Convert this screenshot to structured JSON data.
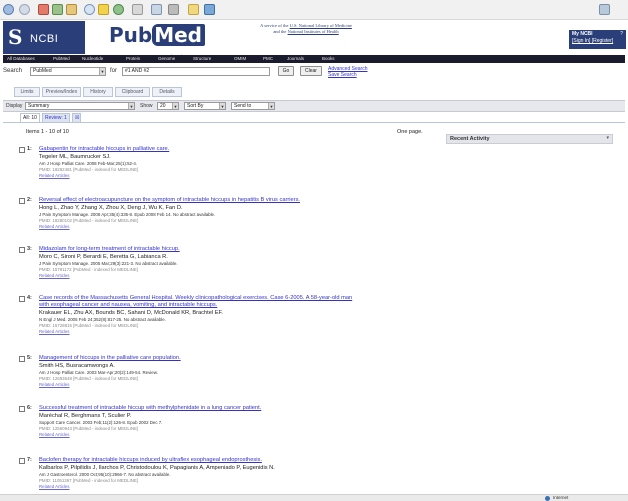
{
  "header": {
    "ncbi_logo_text": "NCBI",
    "pubmed_logo_pub": "Pub",
    "pubmed_logo_med": "Med",
    "pubmed_url": "www.pubmed.gov",
    "service_line1": "A service of the",
    "service_link1": "U.S. National Library of Medicine",
    "service_line2": "and the",
    "service_link2": "National Institutes of Health",
    "my_ncbi_title": "My NCBI",
    "my_ncbi_help": "?",
    "my_ncbi_links": "[Sign In] [Register]"
  },
  "db_nav": [
    "All Databases",
    "PubMed",
    "Nucleotide",
    "Protein",
    "Genome",
    "Structure",
    "OMIM",
    "PMC",
    "Journals",
    "Books"
  ],
  "search": {
    "label": "Search",
    "database": "PubMed",
    "for_label": "for",
    "query": "#1 AND #2",
    "go_label": "Go",
    "clear_label": "Clear",
    "advanced_search": "Advanced Search",
    "save_search": "Save Search"
  },
  "page_tabs": [
    "Limits",
    "Preview/Index",
    "History",
    "Clipboard",
    "Details"
  ],
  "display": {
    "display_label": "Display",
    "display_value": "Summary",
    "show_label": "Show",
    "show_value": "20",
    "sort_value": "Sort By",
    "send_value": "Send to"
  },
  "filter_tabs": {
    "all": "All: 10",
    "review": "Review: 1",
    "icon": "☒"
  },
  "items_count": "Items 1 - 10 of 10",
  "one_page": "One page.",
  "recent_activity": {
    "title": "Recent Activity",
    "collapse": "▾"
  },
  "results": [
    {
      "number": "1:",
      "title_lines": [
        "Gabapentin for intractable hiccups in palliative care."
      ],
      "authors": "Tegeler ML, Baumrucker SJ.",
      "citation": "Am J Hosp Palliat Care. 2008 Feb-Mar;25(1):52-4.",
      "pmid": "PMID: 18292481 [PubMed - indexed for MEDLINE]",
      "related": "Related Articles"
    },
    {
      "number": "2:",
      "title_lines": [
        "Reversal effect of electroacupuncture on the symptom of intractable hiccups in hepatitis B virus carriers."
      ],
      "authors": "Hong L, Zhao Y, Zhang X, Zhou X, Deng J, Wu K, Fan D.",
      "citation": "J Pain Symptom Manage. 2008 Apr;35(4):335-8. Epub 2008 Feb 14. No abstract available.",
      "pmid": "PMID: 18280102 [PubMed - indexed for MEDLINE]",
      "related": "Related Articles"
    },
    {
      "number": "3:",
      "title_lines": [
        "Midazolam for long-term treatment of intractable hiccup."
      ],
      "authors": "Moro C, Sironi P, Berardi E, Beretta G, Labianca R.",
      "citation": "J Pain Symptom Manage. 2005 Mar;29(3):221-3. No abstract available.",
      "pmid": "PMID: 15781172 [PubMed - indexed for MEDLINE]",
      "related": "Related Articles"
    },
    {
      "number": "4:",
      "title_lines": [
        "Case records of the Massachusetts General Hospital. Weekly clinicopathological exercises. Case 6-2005. A 58-year-old man",
        "with esophageal cancer and nausea, vomiting, and intractable hiccups."
      ],
      "authors": "Krakauer EL, Zhu AX, Bounds BC, Sahani D, McDonald KR, Brachtel EF.",
      "citation": "N Engl J Med. 2005 Feb 24;352(8):817-25. No abstract available.",
      "pmid": "PMID: 15728815 [PubMed - indexed for MEDLINE]",
      "related": "Related Articles"
    },
    {
      "number": "5:",
      "title_lines": [
        "Management of hiccups in the palliative care population."
      ],
      "authors": "Smith HS, Busracamwongs A.",
      "citation": "Am J Hosp Palliat Care. 2003 Mar-Apr;20(2):149-54. Review.",
      "pmid": "PMID: 12693648 [PubMed - indexed for MEDLINE]",
      "related": "Related Articles"
    },
    {
      "number": "6:",
      "title_lines": [
        "Successful treatment of intractable hiccup with methylphenidate in a lung cancer patient."
      ],
      "authors": "Maréchal R, Berghmans T, Sculier P.",
      "citation": "Support Care Cancer. 2003 Feb;11(2):126-8. Epub 2002 Dec 7.",
      "pmid": "PMID: 12560943 [PubMed - indexed for MEDLINE]",
      "related": "Related Articles"
    },
    {
      "number": "7:",
      "title_lines": [
        "Baclofen therapy for intractable hiccups induced by ultraflex esophageal endoprosthesis."
      ],
      "authors": "Kalbarlos P, Pilpilidis J, Ilarchos P, Christodoulou K, Papagianis A, Ampeniado P, Eugenidis N.",
      "citation": "Am J Gastroenterol. 2000 Oct;95(10):2966-7. No abstract available.",
      "pmid": "PMID: 11051367 [PubMed - indexed for MEDLINE]",
      "related": "Related Articles"
    }
  ],
  "status_bar": {
    "zone": "Internet"
  },
  "colors": {
    "brand_navy": "#2a3f7a",
    "link_blue": "#3333cc",
    "nav_dark": "#1b1b2e"
  }
}
